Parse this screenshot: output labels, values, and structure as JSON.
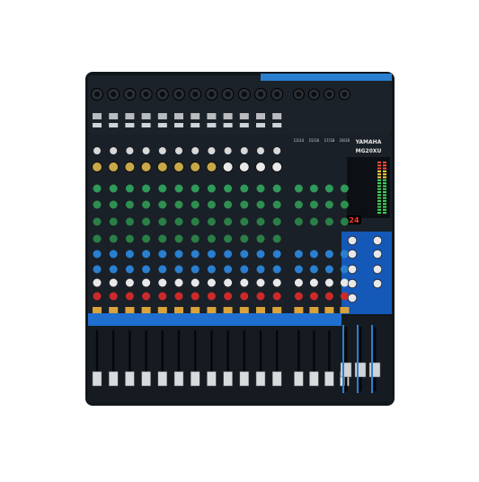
{
  "product": {
    "brand": "YAMAHA",
    "model": "MG20XU"
  },
  "mixer": {
    "mono_channels": 12,
    "stereo_channel_labels": [
      "13/14",
      "15/16",
      "17/18",
      "19/20"
    ],
    "knob_colors": {
      "gain": "#c9a84a",
      "eq_high": "#2f9a5a",
      "eq_mid": "#2e8f4f",
      "eq_low": "#2a7f46",
      "aux": "#2a7fd0",
      "fx": "#e8e8e8",
      "pan": "#cc2a2a"
    },
    "colors": {
      "body": "#161c22",
      "panel": "#1d252d",
      "accent_blue": "#1f6fd0",
      "master_blue": "#1458b8",
      "mute_button": "#d9a23a",
      "meter_green": "#42d65a"
    }
  },
  "master_section": {
    "display_value": "24"
  }
}
